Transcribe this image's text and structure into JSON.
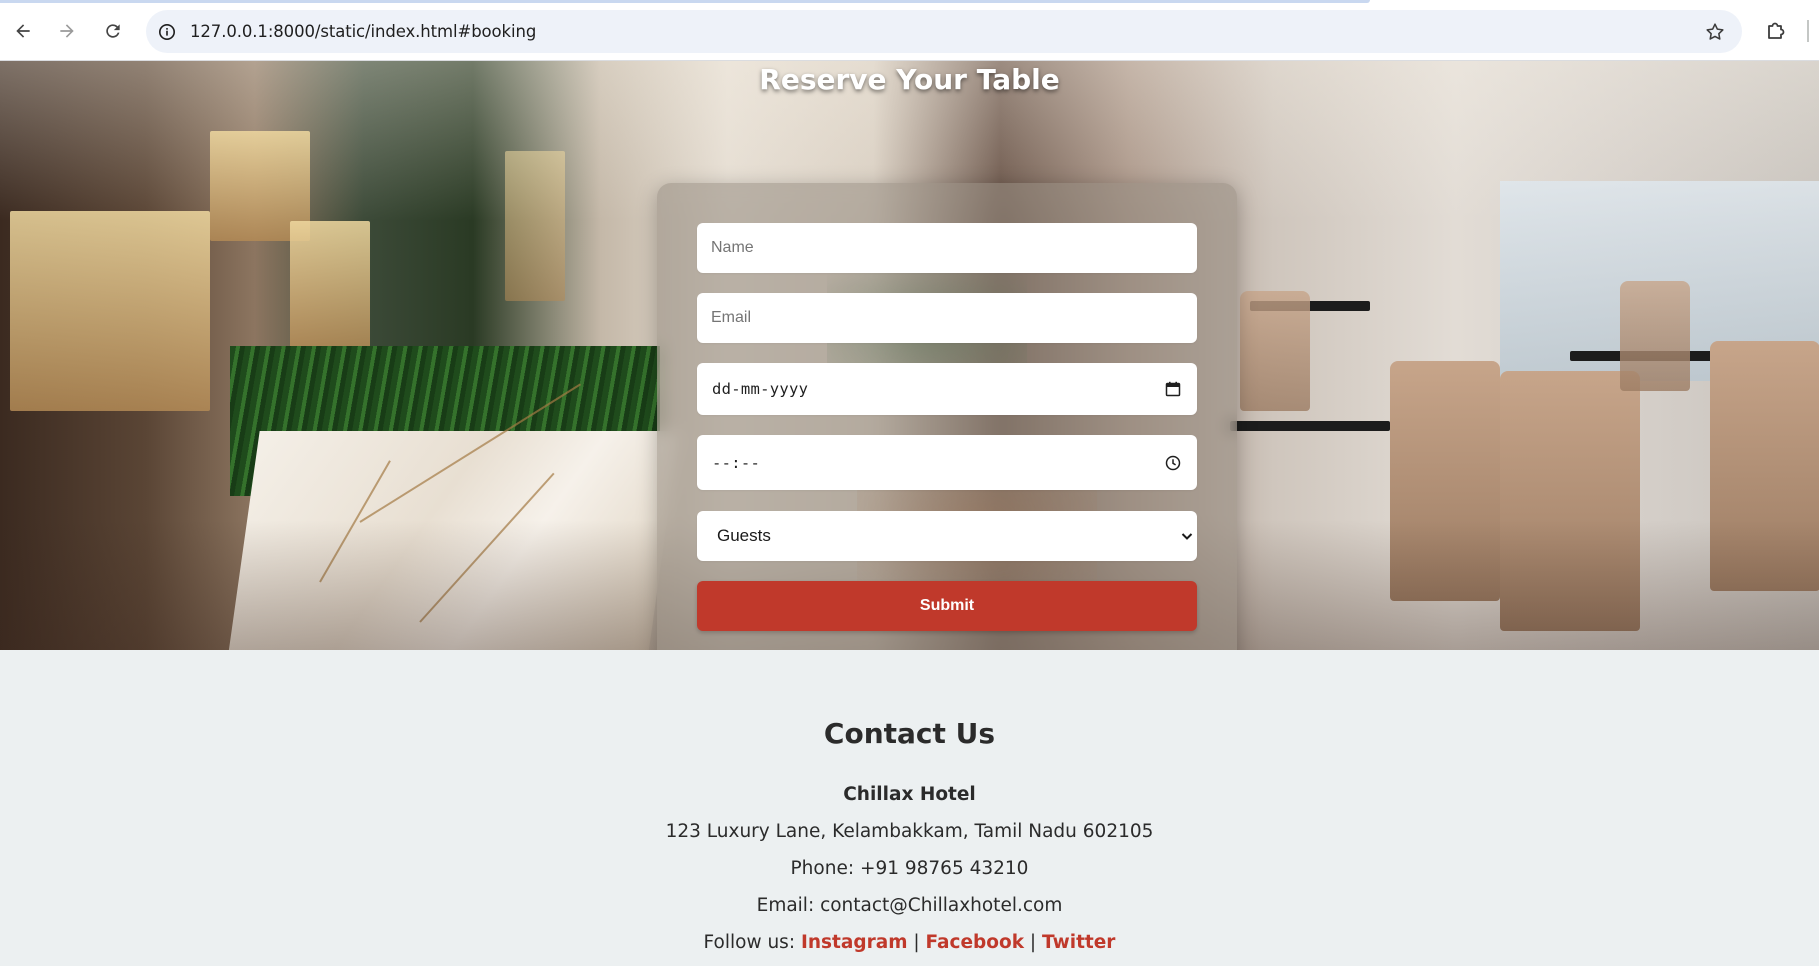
{
  "browser": {
    "url": "127.0.0.1:8000/static/index.html#booking",
    "icons": {
      "back": "arrow-left-icon",
      "forward": "arrow-right-icon",
      "reload": "reload-icon",
      "site_info": "info-circle-icon",
      "bookmark": "star-icon",
      "extensions": "puzzle-icon"
    }
  },
  "booking": {
    "title": "Reserve Your Table",
    "name_placeholder": "Name",
    "email_placeholder": "Email",
    "date_placeholder": "dd-mm-yyyy",
    "time_placeholder": "--:--",
    "guests_selected": "Guests",
    "submit_label": "Submit"
  },
  "contact": {
    "heading": "Contact Us",
    "hotel_name": "Chillax Hotel",
    "address": "123 Luxury Lane, Kelambakkam, Tamil Nadu 602105",
    "phone": "Phone: +91 98765 43210",
    "email": "Email: contact@Chillaxhotel.com",
    "follow_label": "Follow us:",
    "separator": "|",
    "social": [
      "Instagram",
      "Facebook",
      "Twitter"
    ]
  },
  "colors": {
    "accent": "#c0392b",
    "footer_bg": "#ecf0f1",
    "text": "#2b2b2b"
  }
}
